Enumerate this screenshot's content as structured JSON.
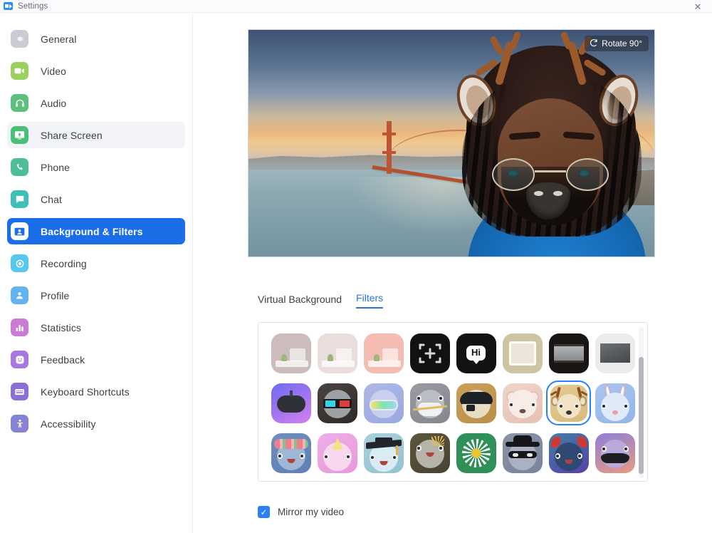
{
  "window": {
    "title": "Settings",
    "logo_icon": "zoom-logo-icon",
    "close_icon": "close-icon"
  },
  "sidebar": {
    "items": [
      {
        "label": "General",
        "icon": "gear-icon",
        "color": "#c9ccd2",
        "state": "default"
      },
      {
        "label": "Video",
        "icon": "video-icon",
        "color": "#9ad05e",
        "state": "default"
      },
      {
        "label": "Audio",
        "icon": "headset-icon",
        "color": "#5cc07c",
        "state": "default"
      },
      {
        "label": "Share Screen",
        "icon": "share-icon",
        "color": "#49bf77",
        "state": "hover"
      },
      {
        "label": "Phone",
        "icon": "phone-icon",
        "color": "#4cbf9a",
        "state": "default"
      },
      {
        "label": "Chat",
        "icon": "chat-icon",
        "color": "#3fbfb6",
        "state": "default"
      },
      {
        "label": "Background & Filters",
        "icon": "person-card-icon",
        "color": "#ffffff",
        "state": "active"
      },
      {
        "label": "Recording",
        "icon": "record-icon",
        "color": "#54c8f0",
        "state": "default"
      },
      {
        "label": "Profile",
        "icon": "profile-icon",
        "color": "#63b3f0",
        "state": "default"
      },
      {
        "label": "Statistics",
        "icon": "bar-chart-icon",
        "color": "#cc7bd4",
        "state": "default"
      },
      {
        "label": "Feedback",
        "icon": "smiley-icon",
        "color": "#a678e0",
        "state": "default"
      },
      {
        "label": "Keyboard Shortcuts",
        "icon": "keyboard-icon",
        "color": "#8b6fd6",
        "state": "default"
      },
      {
        "label": "Accessibility",
        "icon": "accessibility-icon",
        "color": "#7d86d8",
        "state": "default"
      }
    ],
    "active_color": "#1a6fe8"
  },
  "preview": {
    "rotate_label": "Rotate 90°",
    "rotate_icon": "rotate-icon",
    "background_scene": "Golden Gate Bridge at sunset",
    "applied_filter": "Deer"
  },
  "tabs": [
    {
      "label": "Virtual Background",
      "active": false
    },
    {
      "label": "Filters",
      "active": true
    }
  ],
  "tab_accent_color": "#2d75e0",
  "filters": {
    "selected_index": 14,
    "scroll_position": "middle",
    "tiles": [
      {
        "name": "tone-mauve-filter",
        "kind": "room",
        "wall": "#cdbcbc",
        "accent": "#b9a6a6"
      },
      {
        "name": "tone-blush-filter",
        "kind": "room",
        "wall": "#eadedd",
        "accent": "#d7c7c6"
      },
      {
        "name": "tone-pink-filter",
        "kind": "room",
        "wall": "#f5bcb1",
        "accent": "#eaa79c"
      },
      {
        "name": "focus-frame-filter",
        "kind": "glyph",
        "bg": "#121212",
        "glyph": "frame-plus-icon"
      },
      {
        "name": "hi-bubble-filter",
        "kind": "glyph",
        "bg": "#121212",
        "glyph": "hi-speech-bubble-icon",
        "text": "Hi"
      },
      {
        "name": "gold-frame-filter",
        "kind": "frame",
        "bg": "#cdc4a3",
        "inner": "#ebe5da"
      },
      {
        "name": "tv-frame-filter",
        "kind": "frame",
        "bg": "#1a1513",
        "inner": "#8f9296"
      },
      {
        "name": "black-white-filter",
        "kind": "frame",
        "bg": "#eceaea",
        "inner": "#5d6063"
      },
      {
        "name": "vr-headset-filter",
        "kind": "face",
        "bg1": "#6c6bf0",
        "bg2": "#d37ff0",
        "glyph": "vr-headset-icon"
      },
      {
        "name": "3d-glasses-filter",
        "kind": "face",
        "bg1": "#4a4442",
        "bg2": "#2e2a28",
        "glyph": "3d-glasses-icon"
      },
      {
        "name": "ski-goggles-filter",
        "kind": "face",
        "bg1": "#aeb9e8",
        "bg2": "#9aa8e0",
        "glyph": "ski-goggles-icon"
      },
      {
        "name": "face-mask-filter",
        "kind": "face",
        "bg1": "#9a9ba2",
        "bg2": "#85868e",
        "glyph": "medical-mask-icon"
      },
      {
        "name": "pirate-hat-filter",
        "kind": "face",
        "bg1": "#caa05a",
        "bg2": "#b98f48",
        "glyph": "pirate-hat-icon"
      },
      {
        "name": "bear-filter",
        "kind": "face",
        "bg1": "#f0d5cb",
        "bg2": "#e6c0b3",
        "glyph": "bear-icon"
      },
      {
        "name": "deer-filter",
        "kind": "face",
        "bg1": "#e2cb92",
        "bg2": "#d6bb7e",
        "glyph": "deer-icon"
      },
      {
        "name": "rabbit-filter",
        "kind": "face",
        "bg1": "#a8c6ef",
        "bg2": "#93b6e8",
        "glyph": "rabbit-icon"
      },
      {
        "name": "flower-crown-filter",
        "kind": "face",
        "bg1": "#6e8fbf",
        "bg2": "#5d7fb2",
        "glyph": "flower-crown-icon"
      },
      {
        "name": "unicorn-filter",
        "kind": "face",
        "bg1": "#efaee8",
        "bg2": "#e79ad9",
        "glyph": "unicorn-icon"
      },
      {
        "name": "graduation-cap-filter",
        "kind": "face",
        "bg1": "#a9d0dc",
        "bg2": "#95c3d2",
        "glyph": "graduation-cap-icon"
      },
      {
        "name": "sun-crown-filter",
        "kind": "face",
        "bg1": "#5d5640",
        "bg2": "#474231",
        "glyph": "sun-crown-icon"
      },
      {
        "name": "daisy-filter",
        "kind": "face",
        "bg1": "#2f9158",
        "bg2": "#27814c",
        "glyph": "daisy-flower-icon"
      },
      {
        "name": "bandit-hat-filter",
        "kind": "face",
        "bg1": "#8b94a6",
        "bg2": "#79839a",
        "glyph": "bandit-mask-icon"
      },
      {
        "name": "devil-horns-filter",
        "kind": "face",
        "bg1": "#3f7fa8",
        "bg2": "#5a3fa8",
        "glyph": "devil-horns-icon"
      },
      {
        "name": "mustache-filter",
        "kind": "face",
        "bg1": "#8e7fd8",
        "bg2": "#e89a82",
        "glyph": "mustache-icon"
      }
    ]
  },
  "mirror": {
    "label": "Mirror my video",
    "checked": true,
    "check_glyph": "✓",
    "accent": "#2d7ff9"
  }
}
